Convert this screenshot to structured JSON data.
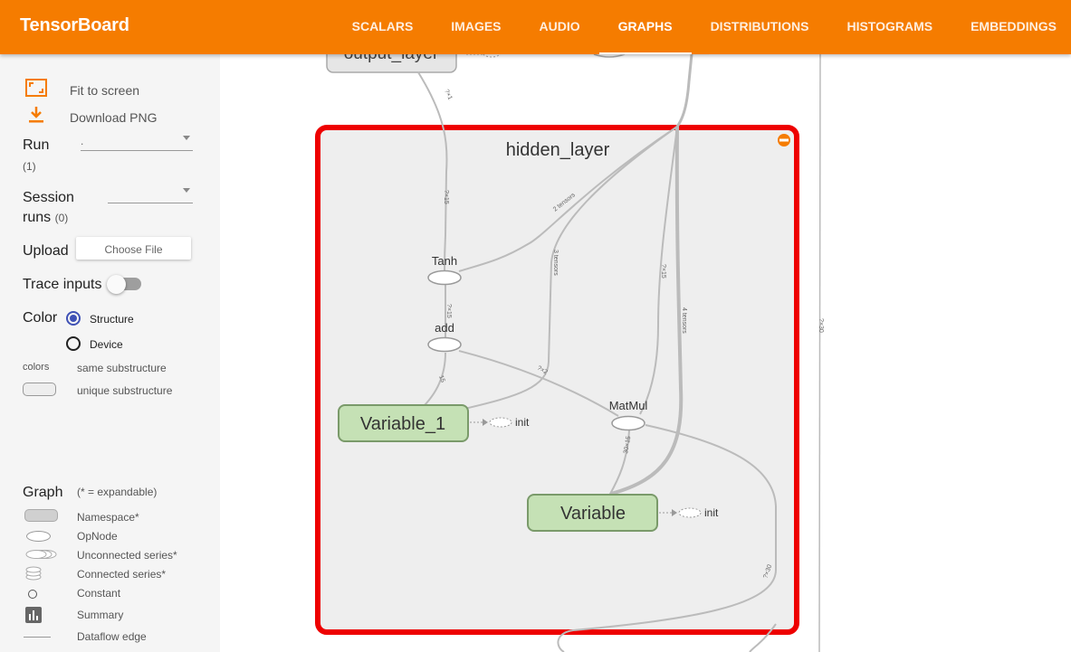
{
  "header": {
    "brand": "TensorBoard",
    "tabs": [
      "SCALARS",
      "IMAGES",
      "AUDIO",
      "GRAPHS",
      "DISTRIBUTIONS",
      "HISTOGRAMS",
      "EMBEDDINGS"
    ],
    "active_tab": "GRAPHS",
    "color": "#f57c00"
  },
  "sidebar": {
    "fit_to_screen": "Fit to screen",
    "download_png": "Download PNG",
    "run_label": "Run",
    "run_count": "(1)",
    "run_value": ".",
    "session_label_1": "Session",
    "session_label_2": "runs",
    "session_count": "(0)",
    "upload_label": "Upload",
    "choose_file": "Choose File",
    "trace_inputs": "Trace inputs",
    "trace_inputs_on": false,
    "color_label": "Color",
    "color_options": [
      "Structure",
      "Device"
    ],
    "color_selected": "Structure",
    "colors_caption": "colors",
    "same_substructure": "same substructure",
    "unique_substructure": "unique substructure",
    "graph_label": "Graph",
    "expandable_note": "(* = expandable)",
    "legend": {
      "namespace": "Namespace*",
      "opnode": "OpNode",
      "unconnected": "Unconnected series*",
      "connected": "Connected series*",
      "constant": "Constant",
      "summary": "Summary",
      "dataflow": "Dataflow edge"
    }
  },
  "graph": {
    "output_node": "output_layer",
    "namespace_title": "hidden_layer",
    "nodes": {
      "tanh": "Tanh",
      "add": "add",
      "matmul": "MatMul",
      "variable_1": "Variable_1",
      "variable": "Variable",
      "init": "init"
    },
    "edge_labels": {
      "output_in": "?×1",
      "tanh_in": "?×15",
      "two_tensors": "2 tensors",
      "three_tensors": "3 tensors",
      "tanh_add": "?×15",
      "matmul_in": "?×15",
      "four_tensors": "4 tensors",
      "add_var1": "15",
      "matmul_add": "?×2",
      "var_matmul": "30×15",
      "right_edge": "?×30",
      "bottom_edge": "?×30"
    },
    "colors": {
      "selection": "#ee0000",
      "variable_fill": "#c5e1b5",
      "variable_stroke": "#7a9a6a",
      "namespace_fill": "#eeeeee"
    }
  }
}
